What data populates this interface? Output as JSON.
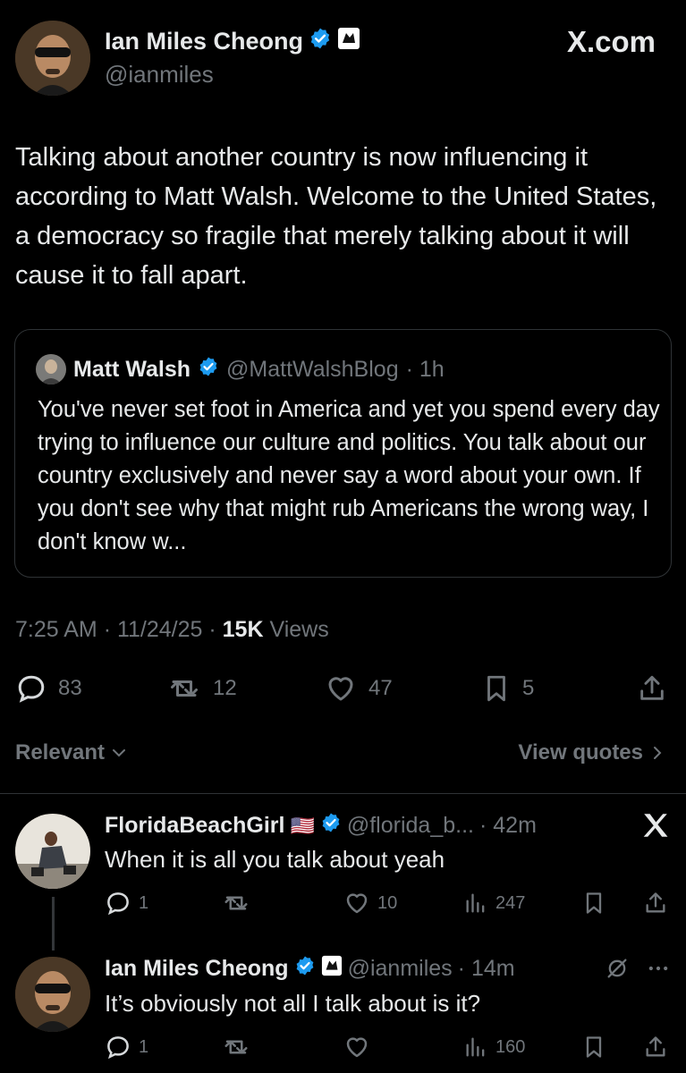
{
  "header": {
    "name": "Ian Miles Cheong",
    "handle": "@ianmiles",
    "watermark": "X.com"
  },
  "tweet": {
    "text": "Talking about another country is now influencing it according to Matt Walsh. Welcome to the United States, a democracy so fragile that merely talking about it will cause it to fall apart."
  },
  "quote": {
    "name": "Matt Walsh",
    "handle": "@MattWalshBlog",
    "time": "· 1h",
    "text": "You've never set foot in America and yet you spend every day trying to influence our culture and politics. You talk about our country exclusively and never say a word about your own. If you don't see why that might rub Americans the wrong way, I don't know w..."
  },
  "meta": {
    "time": "7:25 AM",
    "date": "· 11/24/25 ·",
    "views_count": "15K",
    "views_label": "Views"
  },
  "actions": {
    "replies": "83",
    "reposts": "12",
    "likes": "47",
    "bookmarks": "5"
  },
  "sort": {
    "relevant": "Relevant",
    "view_quotes": "View quotes"
  },
  "replies": [
    {
      "name": "FloridaBeachGirl",
      "flag": "🇺🇸",
      "handle": "@florida_b...",
      "time": "· 42m",
      "text": "When it is all you talk about yeah",
      "reply_count": "1",
      "like_count": "10",
      "views": "247"
    },
    {
      "name": "Ian Miles Cheong",
      "handle": "@ianmiles",
      "time": "· 14m",
      "text": "It’s obviously not all I talk about is it?",
      "reply_count": "1",
      "views": "160"
    }
  ],
  "colors": {
    "background": "#000000",
    "text": "#e7e9ea",
    "muted": "#71767b",
    "verified": "#1d9bf0",
    "border": "#2f3336"
  }
}
